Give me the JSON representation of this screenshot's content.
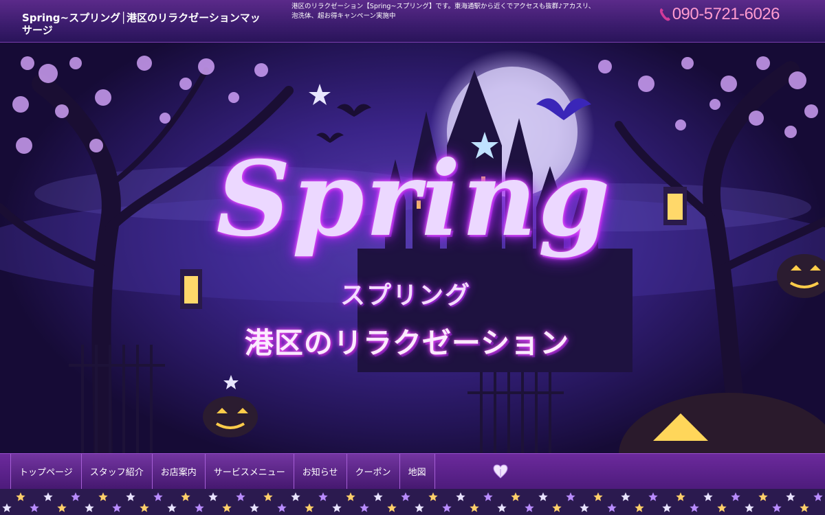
{
  "header": {
    "site_title": "Spring~スプリング│港区のリラクゼーションマッサージ",
    "description": "港区のリラクゼーション【Spring~スプリング】です。東海通駅から近くでアクセスも抜群♪アカスリ、泡洗体、超お得キャンペーン実施中",
    "phone": "090-5721-6026"
  },
  "hero": {
    "title": "Spring",
    "title_kana": "スプリング",
    "subtitle": "港区のリラクゼーション"
  },
  "nav": {
    "items": [
      {
        "label": "トップページ"
      },
      {
        "label": "スタッフ紹介"
      },
      {
        "label": "お店案内"
      },
      {
        "label": "サービスメニュー"
      },
      {
        "label": "お知らせ"
      },
      {
        "label": "クーポン"
      },
      {
        "label": "地図"
      }
    ]
  },
  "colors": {
    "header_bg": "#3b1c6d",
    "phone_text": "#ff9bd0",
    "nav_bg": "#5b2289",
    "accent_glow": "#c02cff"
  },
  "icons": {
    "phone": "phone-icon",
    "heart": "heart-icon"
  }
}
